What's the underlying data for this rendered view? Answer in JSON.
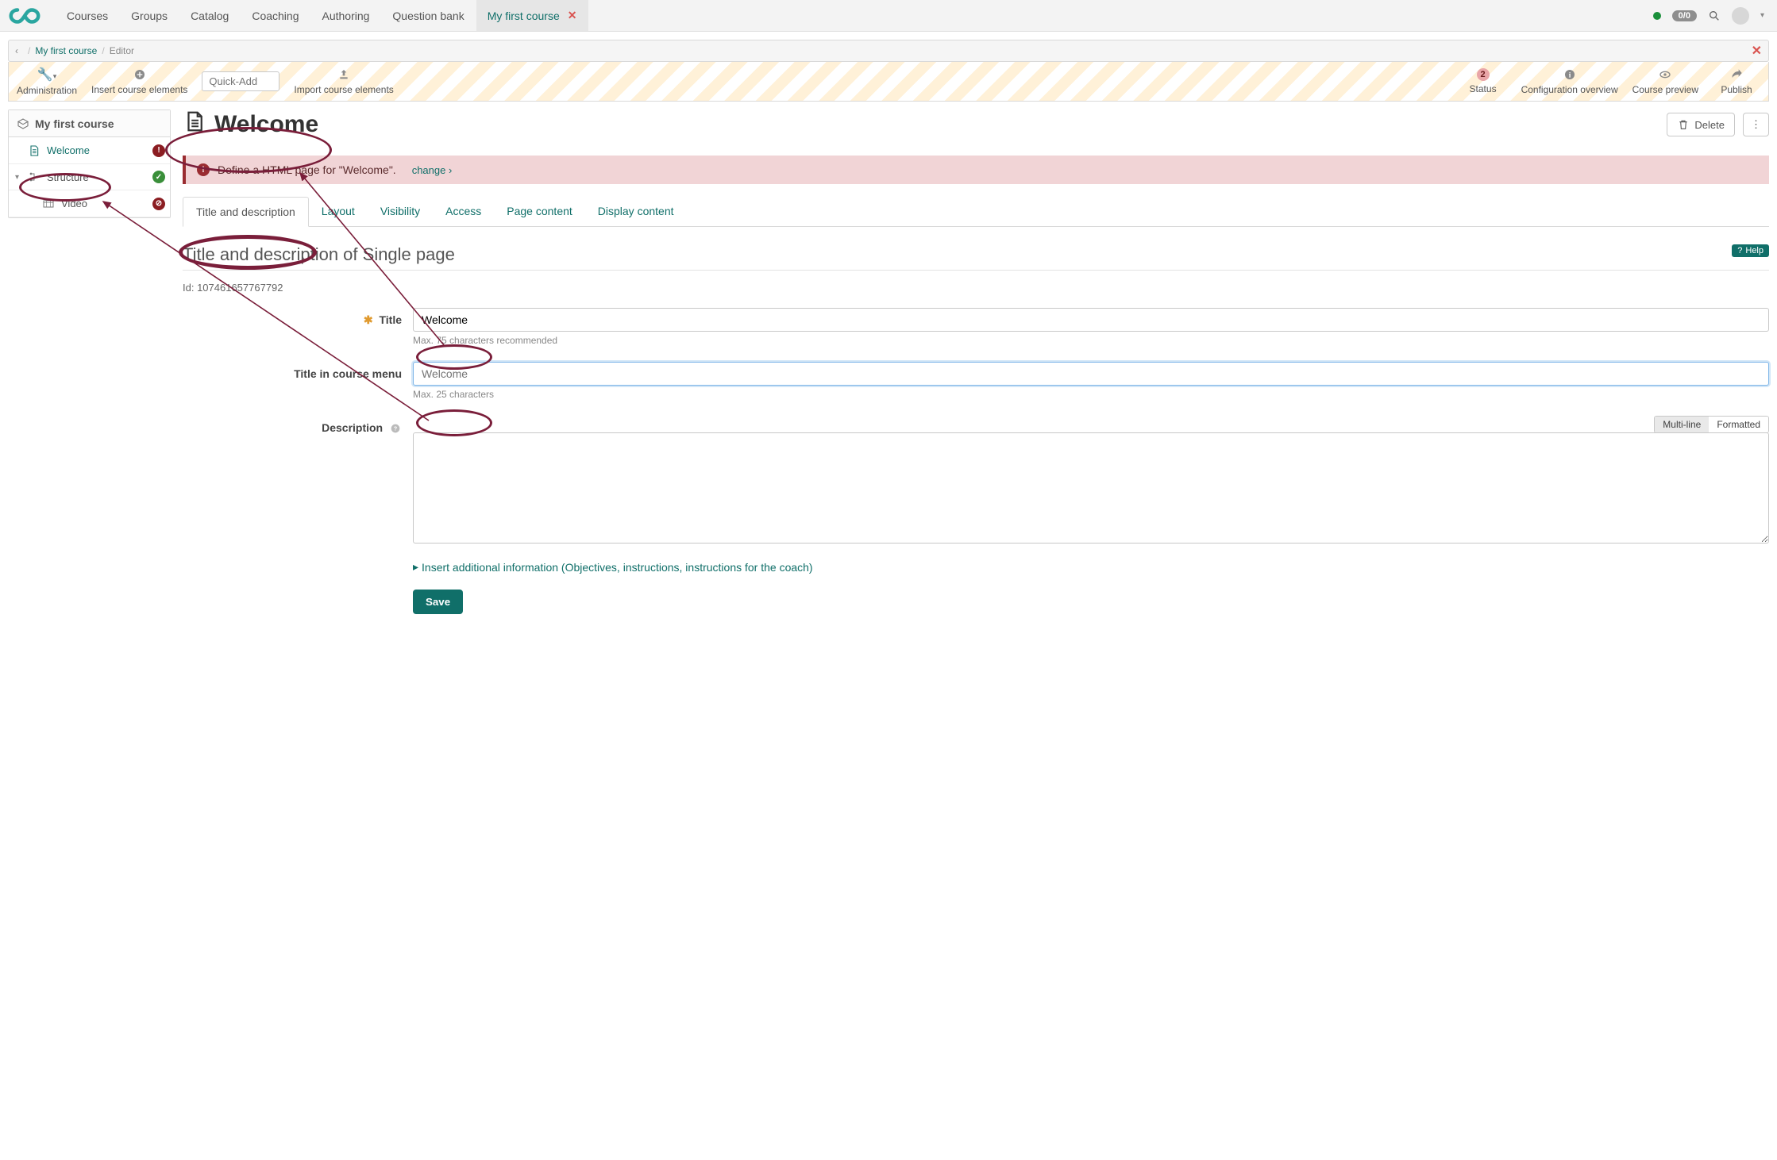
{
  "topnav": {
    "tabs": [
      "Courses",
      "Groups",
      "Catalog",
      "Coaching",
      "Authoring",
      "Question bank"
    ],
    "activeTab": "My first course",
    "counter": "0/0"
  },
  "breadcrumb": {
    "course": "My first course",
    "page": "Editor"
  },
  "toolbar": {
    "administration": "Administration",
    "insertElements": "Insert course elements",
    "quickAddPlaceholder": "Quick-Add",
    "importElements": "Import course elements",
    "status": "Status",
    "statusCount": "2",
    "configOverview": "Configuration overview",
    "coursePreview": "Course preview",
    "publish": "Publish"
  },
  "sidebar": {
    "courseTitle": "My first course",
    "items": [
      {
        "label": "Welcome",
        "icon": "page",
        "active": true,
        "badge": "!",
        "badgeClass": "sb-red"
      },
      {
        "label": "Structure",
        "icon": "structure",
        "active": false,
        "badge": "✓",
        "badgeClass": "sb-green",
        "caret": true
      },
      {
        "label": "Video",
        "icon": "video",
        "active": false,
        "badge": "⊘",
        "badgeClass": "sb-red",
        "sub": true
      }
    ]
  },
  "page": {
    "title": "Welcome",
    "deleteLabel": "Delete"
  },
  "alert": {
    "text": "Define a HTML page for \"Welcome\".",
    "changeLabel": "change"
  },
  "tabs": [
    "Title and description",
    "Layout",
    "Visibility",
    "Access",
    "Page content",
    "Display content"
  ],
  "section": {
    "heading": "Title and description of Single page",
    "helpLabel": "Help",
    "idLabel": "Id: 107461657767792"
  },
  "form": {
    "titleLabel": "Title",
    "titleValue": "Welcome",
    "titleHint": "Max. 75 characters recommended",
    "menuTitleLabel": "Title in course menu",
    "menuTitlePlaceholder": "Welcome",
    "menuTitleHint": "Max. 25 characters",
    "descriptionLabel": "Description",
    "segMulti": "Multi-line",
    "segFormatted": "Formatted",
    "insertMore": "Insert additional information (Objectives, instructions, instructions for the coach)",
    "saveLabel": "Save"
  }
}
